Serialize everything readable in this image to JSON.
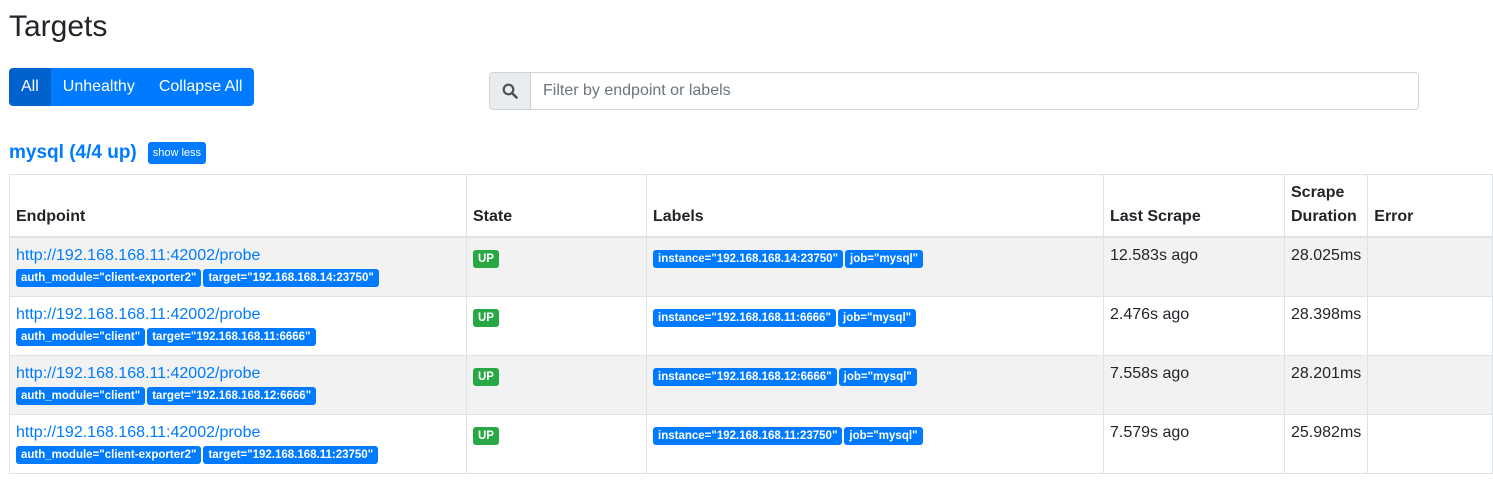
{
  "page": {
    "title": "Targets"
  },
  "filters": {
    "all": "All",
    "unhealthy": "Unhealthy",
    "collapse": "Collapse All"
  },
  "search": {
    "placeholder": "Filter by endpoint or labels",
    "icon": "search-icon"
  },
  "pool": {
    "title": "mysql (4/4 up)",
    "toggle": "show less"
  },
  "table": {
    "headers": {
      "endpoint": "Endpoint",
      "state": "State",
      "labels": "Labels",
      "last_scrape": "Last Scrape",
      "scrape_duration": "Scrape Duration",
      "error": "Error"
    },
    "rows": [
      {
        "endpoint": "http://192.168.168.11:42002/probe",
        "params": [
          "auth_module=\"client-exporter2\"",
          "target=\"192.168.168.14:23750\""
        ],
        "state": "UP",
        "labels": [
          "instance=\"192.168.168.14:23750\"",
          "job=\"mysql\""
        ],
        "last_scrape": "12.583s ago",
        "duration": "28.025ms",
        "error": ""
      },
      {
        "endpoint": "http://192.168.168.11:42002/probe",
        "params": [
          "auth_module=\"client\"",
          "target=\"192.168.168.11:6666\""
        ],
        "state": "UP",
        "labels": [
          "instance=\"192.168.168.11:6666\"",
          "job=\"mysql\""
        ],
        "last_scrape": "2.476s ago",
        "duration": "28.398ms",
        "error": ""
      },
      {
        "endpoint": "http://192.168.168.11:42002/probe",
        "params": [
          "auth_module=\"client\"",
          "target=\"192.168.168.12:6666\""
        ],
        "state": "UP",
        "labels": [
          "instance=\"192.168.168.12:6666\"",
          "job=\"mysql\""
        ],
        "last_scrape": "7.558s ago",
        "duration": "28.201ms",
        "error": ""
      },
      {
        "endpoint": "http://192.168.168.11:42002/probe",
        "params": [
          "auth_module=\"client-exporter2\"",
          "target=\"192.168.168.11:23750\""
        ],
        "state": "UP",
        "labels": [
          "instance=\"192.168.168.11:23750\"",
          "job=\"mysql\""
        ],
        "last_scrape": "7.579s ago",
        "duration": "25.982ms",
        "error": ""
      }
    ]
  },
  "colors": {
    "primary": "#007bff",
    "active": "#0062cc",
    "success": "#28a745",
    "stripe": "#f2f2f2"
  }
}
